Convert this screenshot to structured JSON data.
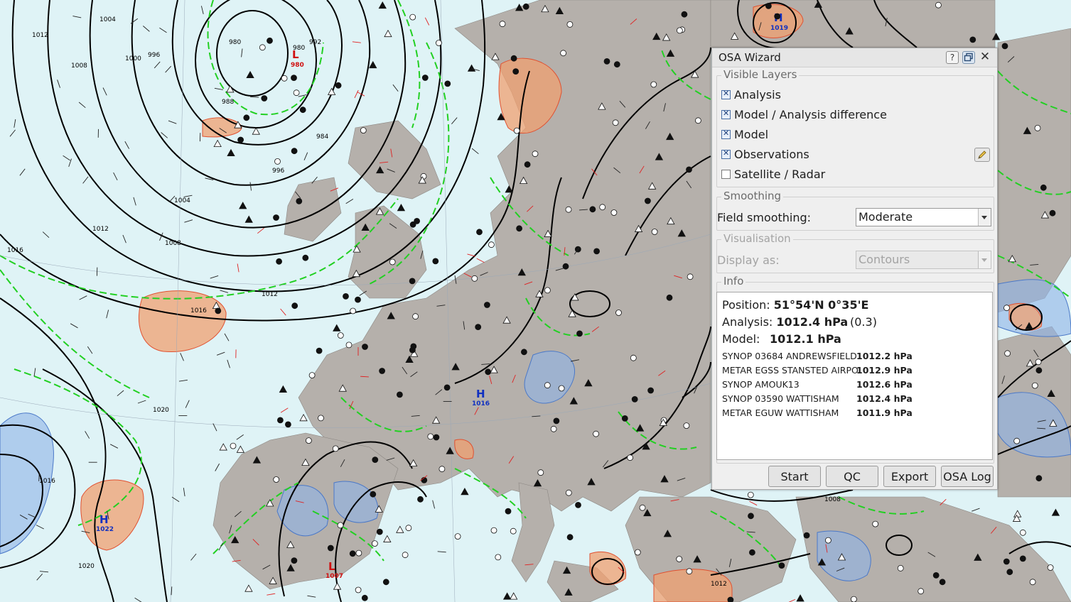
{
  "map": {
    "pressure_labels": [
      "980",
      "984",
      "988",
      "992",
      "996",
      "1000",
      "1004",
      "1008",
      "1012",
      "1016",
      "1020"
    ],
    "centers": [
      {
        "kind": "L",
        "value": "980"
      },
      {
        "kind": "H",
        "value": "1022"
      },
      {
        "kind": "H",
        "value": "1016"
      },
      {
        "kind": "H",
        "value": "1019"
      },
      {
        "kind": "L",
        "value": "1007"
      }
    ]
  },
  "dialog": {
    "title": "OSA Wizard",
    "help_glyph": "?",
    "close_glyph": "✕",
    "visible_layers": {
      "legend": "Visible Layers",
      "items": [
        {
          "label": "Analysis",
          "checked": true
        },
        {
          "label": "Model / Analysis difference",
          "checked": true
        },
        {
          "label": "Model",
          "checked": true
        },
        {
          "label": "Observations",
          "checked": true
        },
        {
          "label": "Satellite / Radar",
          "checked": false
        }
      ]
    },
    "smoothing": {
      "legend": "Smoothing",
      "label": "Field smoothing:",
      "value": "Moderate"
    },
    "visualisation": {
      "legend": "Visualisation",
      "label": "Display as:",
      "value": "Contours"
    },
    "info": {
      "legend": "Info",
      "position_label": "Position:",
      "position_value": "51°54'N 0°35'E",
      "analysis_label": "Analysis:",
      "analysis_value": "1012.4 hPa",
      "analysis_diff": "(0.3)",
      "model_label": "Model:",
      "model_value": "1012.1 hPa",
      "stations": [
        {
          "name": "SYNOP 03684 ANDREWSFIELD",
          "value": "1012.2 hPa"
        },
        {
          "name": "METAR EGSS STANSTED AIRPO",
          "value": "1012.9 hPa"
        },
        {
          "name": "SYNOP AMOUK13",
          "value": "1012.6 hPa"
        },
        {
          "name": "SYNOP 03590 WATTISHAM",
          "value": "1012.4 hPa"
        },
        {
          "name": "METAR EGUW WATTISHAM",
          "value": "1011.9 hPa"
        }
      ]
    },
    "buttons": {
      "start": "Start",
      "qc": "QC",
      "export": "Export",
      "log": "OSA Log"
    }
  },
  "colors": {
    "sea": "#dff3f6",
    "land": "#b5b0ab",
    "isobar": "#000000",
    "analysis_diff": "#22d022",
    "warm_anomaly": "#f0a070",
    "cold_anomaly": "#8fb4e8",
    "obs_red": "#e02020",
    "center_high": "#1030c0",
    "center_low": "#d01010"
  }
}
